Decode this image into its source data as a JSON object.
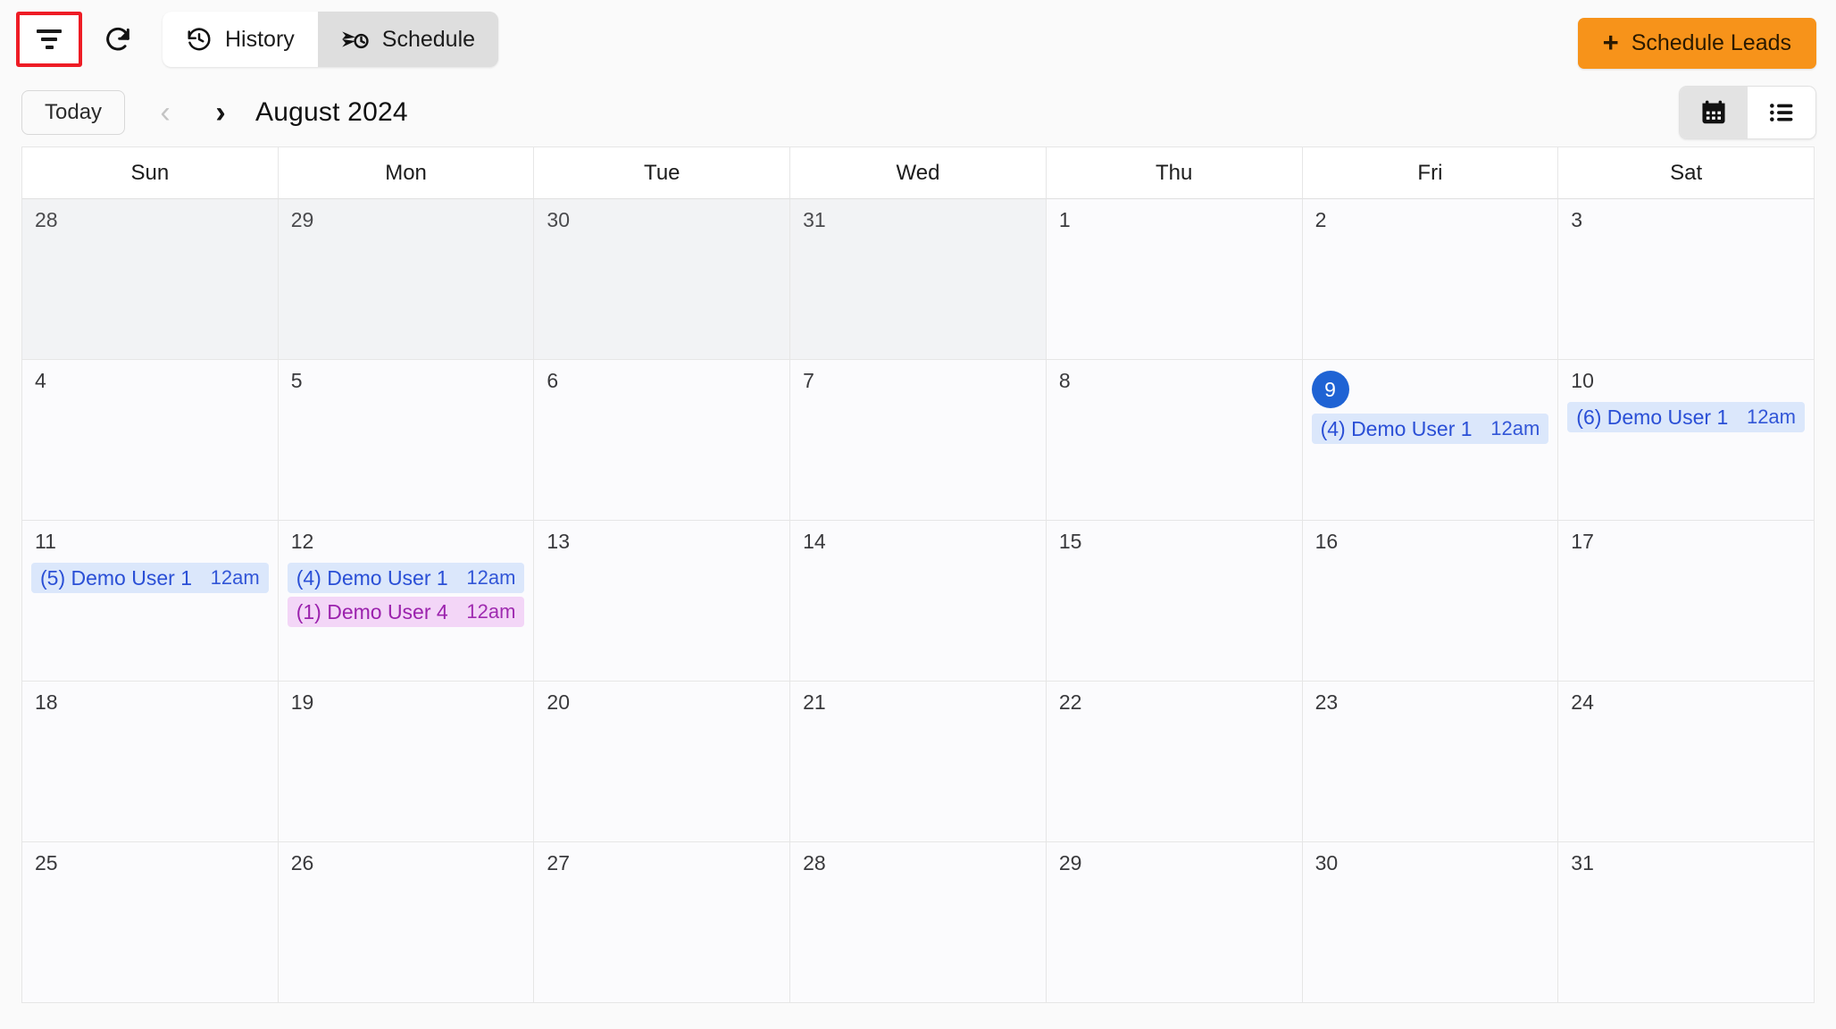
{
  "toolbar": {
    "filter_icon": "filter-icon",
    "refresh_icon": "refresh-icon",
    "tabs": [
      {
        "label": "History",
        "icon": "history-clock-icon",
        "active": true
      },
      {
        "label": "Schedule",
        "icon": "send-clock-icon",
        "active": false
      }
    ],
    "primary_action": {
      "label": "Schedule Leads",
      "icon": "plus-icon",
      "color": "#f7931a"
    }
  },
  "nav": {
    "today_label": "Today",
    "prev_label": "‹",
    "next_label": "›",
    "month_title": "August 2024",
    "views": [
      {
        "name": "calendar-view",
        "icon": "calendar-icon",
        "active": true
      },
      {
        "name": "list-view",
        "icon": "list-icon",
        "active": false
      }
    ]
  },
  "calendar": {
    "day_headers": [
      "Sun",
      "Mon",
      "Tue",
      "Wed",
      "Thu",
      "Fri",
      "Sat"
    ],
    "accent_today": "#1f63d4",
    "event_colors": {
      "blue_bg": "#dbe7fb",
      "blue_fg": "#2a4fd6",
      "purple_bg": "#f3d6f7",
      "purple_fg": "#9b22ad"
    },
    "weeks": [
      [
        {
          "day": "28",
          "other": true,
          "today": false,
          "events": []
        },
        {
          "day": "29",
          "other": true,
          "today": false,
          "events": []
        },
        {
          "day": "30",
          "other": true,
          "today": false,
          "events": []
        },
        {
          "day": "31",
          "other": true,
          "today": false,
          "events": []
        },
        {
          "day": "1",
          "other": false,
          "today": false,
          "events": []
        },
        {
          "day": "2",
          "other": false,
          "today": false,
          "events": []
        },
        {
          "day": "3",
          "other": false,
          "today": false,
          "events": []
        }
      ],
      [
        {
          "day": "4",
          "other": false,
          "today": false,
          "events": []
        },
        {
          "day": "5",
          "other": false,
          "today": false,
          "events": []
        },
        {
          "day": "6",
          "other": false,
          "today": false,
          "events": []
        },
        {
          "day": "7",
          "other": false,
          "today": false,
          "events": []
        },
        {
          "day": "8",
          "other": false,
          "today": false,
          "events": []
        },
        {
          "day": "9",
          "other": false,
          "today": true,
          "events": [
            {
              "title": "(4) Demo User 1",
              "time": "12am",
              "color": "blue"
            }
          ]
        },
        {
          "day": "10",
          "other": false,
          "today": false,
          "events": [
            {
              "title": "(6) Demo User 1",
              "time": "12am",
              "color": "blue"
            }
          ]
        }
      ],
      [
        {
          "day": "11",
          "other": false,
          "today": false,
          "events": [
            {
              "title": "(5) Demo User 1",
              "time": "12am",
              "color": "blue"
            }
          ]
        },
        {
          "day": "12",
          "other": false,
          "today": false,
          "events": [
            {
              "title": "(4) Demo User 1",
              "time": "12am",
              "color": "blue"
            },
            {
              "title": "(1) Demo User 4",
              "time": "12am",
              "color": "purple"
            }
          ]
        },
        {
          "day": "13",
          "other": false,
          "today": false,
          "events": []
        },
        {
          "day": "14",
          "other": false,
          "today": false,
          "events": []
        },
        {
          "day": "15",
          "other": false,
          "today": false,
          "events": []
        },
        {
          "day": "16",
          "other": false,
          "today": false,
          "events": []
        },
        {
          "day": "17",
          "other": false,
          "today": false,
          "events": []
        }
      ],
      [
        {
          "day": "18",
          "other": false,
          "today": false,
          "events": []
        },
        {
          "day": "19",
          "other": false,
          "today": false,
          "events": []
        },
        {
          "day": "20",
          "other": false,
          "today": false,
          "events": []
        },
        {
          "day": "21",
          "other": false,
          "today": false,
          "events": []
        },
        {
          "day": "22",
          "other": false,
          "today": false,
          "events": []
        },
        {
          "day": "23",
          "other": false,
          "today": false,
          "events": []
        },
        {
          "day": "24",
          "other": false,
          "today": false,
          "events": []
        }
      ],
      [
        {
          "day": "25",
          "other": false,
          "today": false,
          "events": []
        },
        {
          "day": "26",
          "other": false,
          "today": false,
          "events": []
        },
        {
          "day": "27",
          "other": false,
          "today": false,
          "events": []
        },
        {
          "day": "28",
          "other": false,
          "today": false,
          "events": []
        },
        {
          "day": "29",
          "other": false,
          "today": false,
          "events": []
        },
        {
          "day": "30",
          "other": false,
          "today": false,
          "events": []
        },
        {
          "day": "31",
          "other": false,
          "today": false,
          "events": []
        }
      ]
    ]
  }
}
